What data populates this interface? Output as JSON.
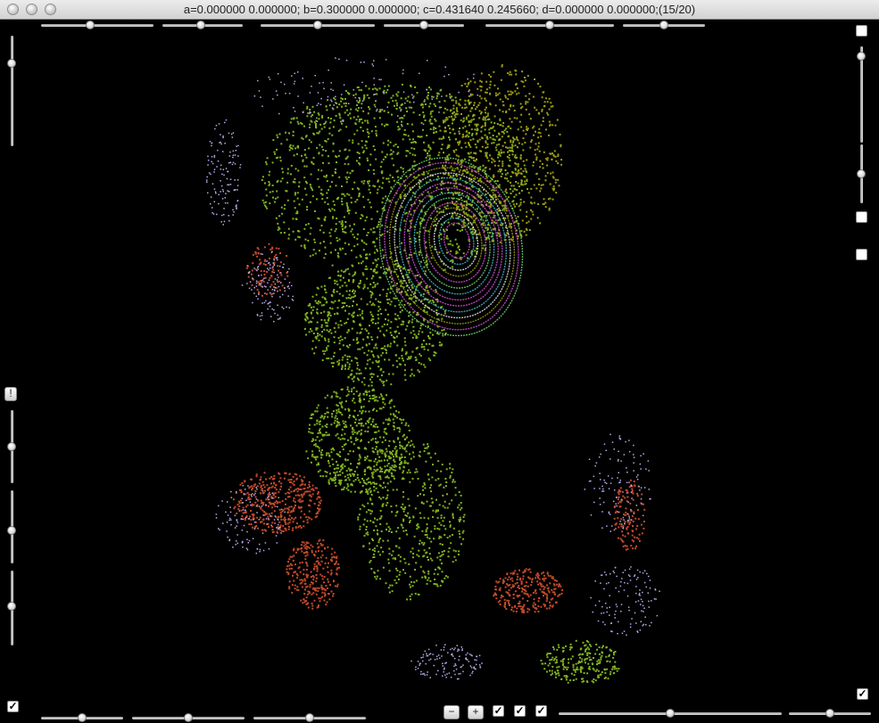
{
  "window": {
    "title": "a=0.000000 0.000000; b=0.300000 0.000000; c=0.431640 0.245660; d=0.000000 0.000000;(15/20)"
  },
  "controls": {
    "alert_label": "!",
    "minus_label": "−",
    "plus_label": "+",
    "check_mark": "✓"
  },
  "sliders": {
    "top_left_1": 0.44,
    "top_left_2": 0.48,
    "top_mid_1": 0.5,
    "top_mid_2": 0.5,
    "top_right_1": 0.5,
    "top_right_2": 0.5,
    "bottom_left_1": 0.5,
    "bottom_left_2": 0.5,
    "bottom_mid": 0.5,
    "bottom_right_1": 0.5,
    "bottom_right_2": 0.5,
    "left_v_1": 0.75,
    "left_v_2": 0.5,
    "left_v_3": 0.45,
    "left_v_4": 0.52,
    "right_v_1": 0.9,
    "right_v_2": 0.5
  },
  "colors": {
    "background": "#000000",
    "fractal_green": "#7fb21e",
    "fractal_olive": "#9a9a12",
    "fractal_red": "#c04a2a",
    "ring_magenta": "#d04fd0",
    "ring_cyan": "#3fb8c8",
    "dot_lilac": "#b8a8e8"
  }
}
